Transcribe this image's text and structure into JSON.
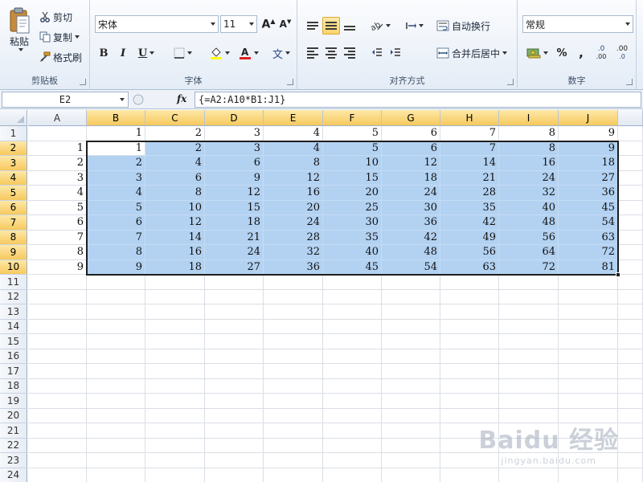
{
  "colors": {
    "selection_fill": "#b3d2f2",
    "header_selected": "#f7c95d",
    "ribbon_bg": "#e4ecf6"
  },
  "ribbon": {
    "clipboard": {
      "paste": "粘贴",
      "cut": "剪切",
      "copy": "复制",
      "format_painter": "格式刷",
      "label": "剪贴板"
    },
    "font": {
      "name": "宋体",
      "size": "11",
      "bold": "B",
      "italic": "I",
      "underline": "U",
      "phonetic": "文",
      "label": "字体"
    },
    "alignment": {
      "wrap_text": "自动换行",
      "merge_center": "合并后居中",
      "label": "对齐方式"
    },
    "number": {
      "format": "常规",
      "percent": "%",
      "comma": ",",
      "inc_decimal": ".0",
      "dec_decimal": ".00",
      "label": "数字"
    }
  },
  "formula_bar": {
    "name_box": "E2",
    "fx": "fx",
    "formula": "{=A2:A10*B1:J1}"
  },
  "grid": {
    "columns": [
      "A",
      "B",
      "C",
      "D",
      "E",
      "F",
      "G",
      "H",
      "I",
      "J"
    ],
    "rows": [
      "1",
      "2",
      "3",
      "4",
      "5",
      "6",
      "7",
      "8",
      "9",
      "10",
      "11",
      "12",
      "13",
      "14",
      "15",
      "16",
      "17",
      "18",
      "19",
      "20",
      "21",
      "22",
      "23",
      "24"
    ],
    "cells": [
      [
        "",
        "1",
        "2",
        "3",
        "4",
        "5",
        "6",
        "7",
        "8",
        "9"
      ],
      [
        "1",
        "1",
        "2",
        "3",
        "4",
        "5",
        "6",
        "7",
        "8",
        "9"
      ],
      [
        "2",
        "2",
        "4",
        "6",
        "8",
        "10",
        "12",
        "14",
        "16",
        "18"
      ],
      [
        "3",
        "3",
        "6",
        "9",
        "12",
        "15",
        "18",
        "21",
        "24",
        "27"
      ],
      [
        "4",
        "4",
        "8",
        "12",
        "16",
        "20",
        "24",
        "28",
        "32",
        "36"
      ],
      [
        "5",
        "5",
        "10",
        "15",
        "20",
        "25",
        "30",
        "35",
        "40",
        "45"
      ],
      [
        "6",
        "6",
        "12",
        "18",
        "24",
        "30",
        "36",
        "42",
        "48",
        "54"
      ],
      [
        "7",
        "7",
        "14",
        "21",
        "28",
        "35",
        "42",
        "49",
        "56",
        "63"
      ],
      [
        "8",
        "8",
        "16",
        "24",
        "32",
        "40",
        "48",
        "56",
        "64",
        "72"
      ],
      [
        "9",
        "9",
        "18",
        "27",
        "36",
        "45",
        "54",
        "63",
        "72",
        "81"
      ]
    ],
    "selected_columns": [
      "B",
      "C",
      "D",
      "E",
      "F",
      "G",
      "H",
      "I",
      "J"
    ],
    "selected_rows": [
      "2",
      "3",
      "4",
      "5",
      "6",
      "7",
      "8",
      "9",
      "10"
    ]
  },
  "watermark": {
    "brand": "Baidu 经验",
    "url": "jingyan.baidu.com"
  }
}
